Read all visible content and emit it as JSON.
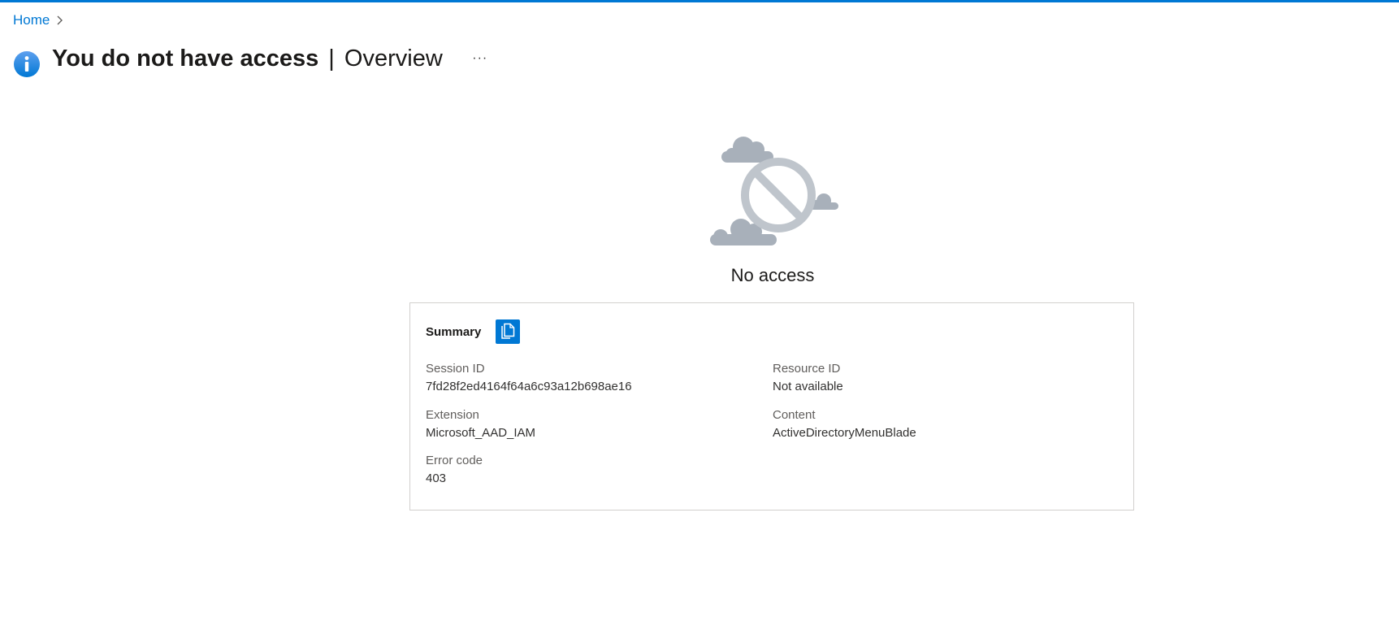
{
  "breadcrumb": {
    "home_label": "Home"
  },
  "header": {
    "title": "You do not have access",
    "separator": "|",
    "subtitle": "Overview",
    "more_label": "···",
    "icon": "info-icon"
  },
  "main": {
    "illustration_icon": "no-access-cloud-icon",
    "status_text": "No access"
  },
  "summary": {
    "title": "Summary",
    "copy_icon": "copy-icon",
    "fields": {
      "session_id": {
        "label": "Session ID",
        "value": "7fd28f2ed4164f64a6c93a12b698ae16"
      },
      "resource_id": {
        "label": "Resource ID",
        "value": "Not available"
      },
      "extension": {
        "label": "Extension",
        "value": "Microsoft_AAD_IAM"
      },
      "content": {
        "label": "Content",
        "value": "ActiveDirectoryMenuBlade"
      },
      "error_code": {
        "label": "Error code",
        "value": "403"
      }
    }
  },
  "colors": {
    "accent": "#0078d4",
    "illustration_gray": "#a8b0ba",
    "border": "#d2d0ce"
  }
}
